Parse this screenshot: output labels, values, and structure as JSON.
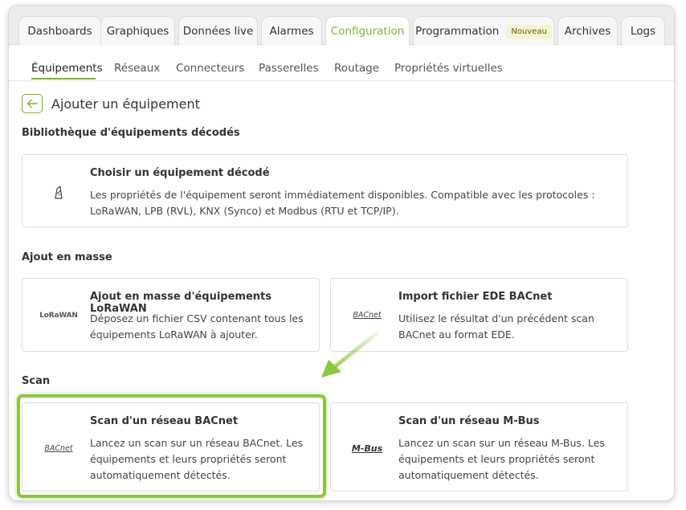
{
  "tabs": [
    {
      "label": "Dashboards"
    },
    {
      "label": "Graphiques"
    },
    {
      "label": "Données live"
    },
    {
      "label": "Alarmes"
    },
    {
      "label": "Configuration"
    },
    {
      "label": "Programmation",
      "badge": "Nouveau"
    },
    {
      "label": "Archives"
    },
    {
      "label": "Logs"
    }
  ],
  "subtabs": [
    {
      "label": "Équipements"
    },
    {
      "label": "Réseaux"
    },
    {
      "label": "Connecteurs"
    },
    {
      "label": "Passerelles"
    },
    {
      "label": "Routage"
    },
    {
      "label": "Propriétés virtuelles"
    }
  ],
  "page": {
    "title": "Ajouter un équipement"
  },
  "sections": {
    "library": "Bibliothèque d'équipements décodés",
    "bulk": "Ajout en masse",
    "scan": "Scan"
  },
  "cards": {
    "decoded": {
      "title": "Choisir un équipement décodé",
      "line1": "Les propriétés de l'équipement seront immédiatement disponibles. Compatible avec les protocoles :",
      "line2": "LoRaWAN, LPB (RVL), KNX (Synco) et Modbus (RTU et TCP/IP)."
    },
    "lorawan_bulk": {
      "logo": "LoRaWAN",
      "title": "Ajout en masse d'équipements LoRaWAN",
      "line1": "Déposez un fichier CSV contenant tous les",
      "line2": "équipements LoRaWAN à ajouter."
    },
    "ede_import": {
      "logo": "BACnet",
      "title": "Import fichier EDE BACnet",
      "line1": "Utilisez le résultat d'un précédent scan",
      "line2": "BACnet au format EDE."
    },
    "bacnet_scan": {
      "logo": "BACnet",
      "title": "Scan d'un réseau BACnet",
      "line1": "Lancez un scan sur un réseau BACnet. Les",
      "line2": "équipements et leurs propriétés seront",
      "line3": "automatiquement détectés."
    },
    "mbus_scan": {
      "logo": "M-Bus",
      "title": "Scan d'un réseau M-Bus",
      "line1": "Lancez un scan sur un réseau M-Bus. Les",
      "line2": "équipements et leurs propriétés seront",
      "line3": "automatiquement détectés."
    }
  },
  "colors": {
    "accent": "#79b530",
    "highlight": "#8cc63f",
    "badge_bg": "#f6f4cc"
  },
  "icons": {
    "back": "arrow-left-icon",
    "decoded_device": "device-outline-icon"
  }
}
